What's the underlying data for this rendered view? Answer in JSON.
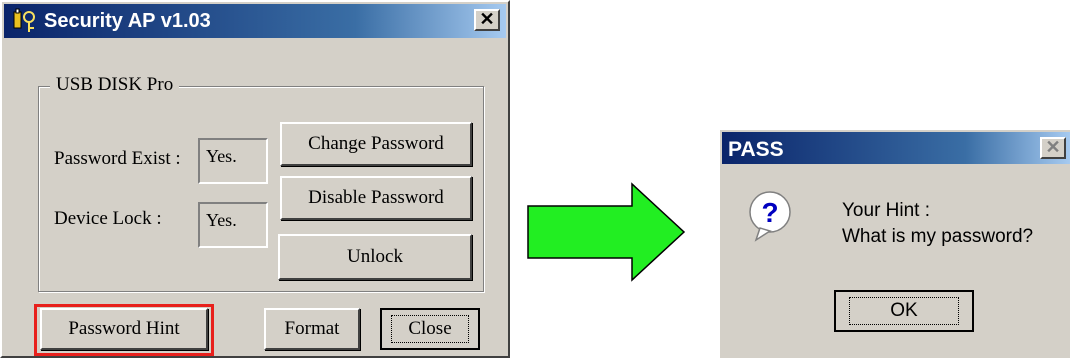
{
  "security_window": {
    "title": "Security AP v1.03",
    "close_glyph": "✕",
    "group_title": "USB DISK Pro",
    "password_exist_label": "Password Exist :",
    "password_exist_value": "Yes.",
    "device_lock_label": "Device Lock :",
    "device_lock_value": "Yes.",
    "buttons": {
      "change_password": "Change Password",
      "disable_password": "Disable Password",
      "unlock": "Unlock",
      "password_hint": "Password Hint",
      "format": "Format",
      "close": "Close"
    }
  },
  "pass_dialog": {
    "title": "PASS",
    "close_glyph": "✕",
    "message_line1": "Your Hint :",
    "message_line2": "What is my password?",
    "ok_label": "OK"
  },
  "colors": {
    "titlebar": "#0a246a",
    "highlight_border": "#e8201c",
    "arrow_fill": "#22ee22"
  }
}
